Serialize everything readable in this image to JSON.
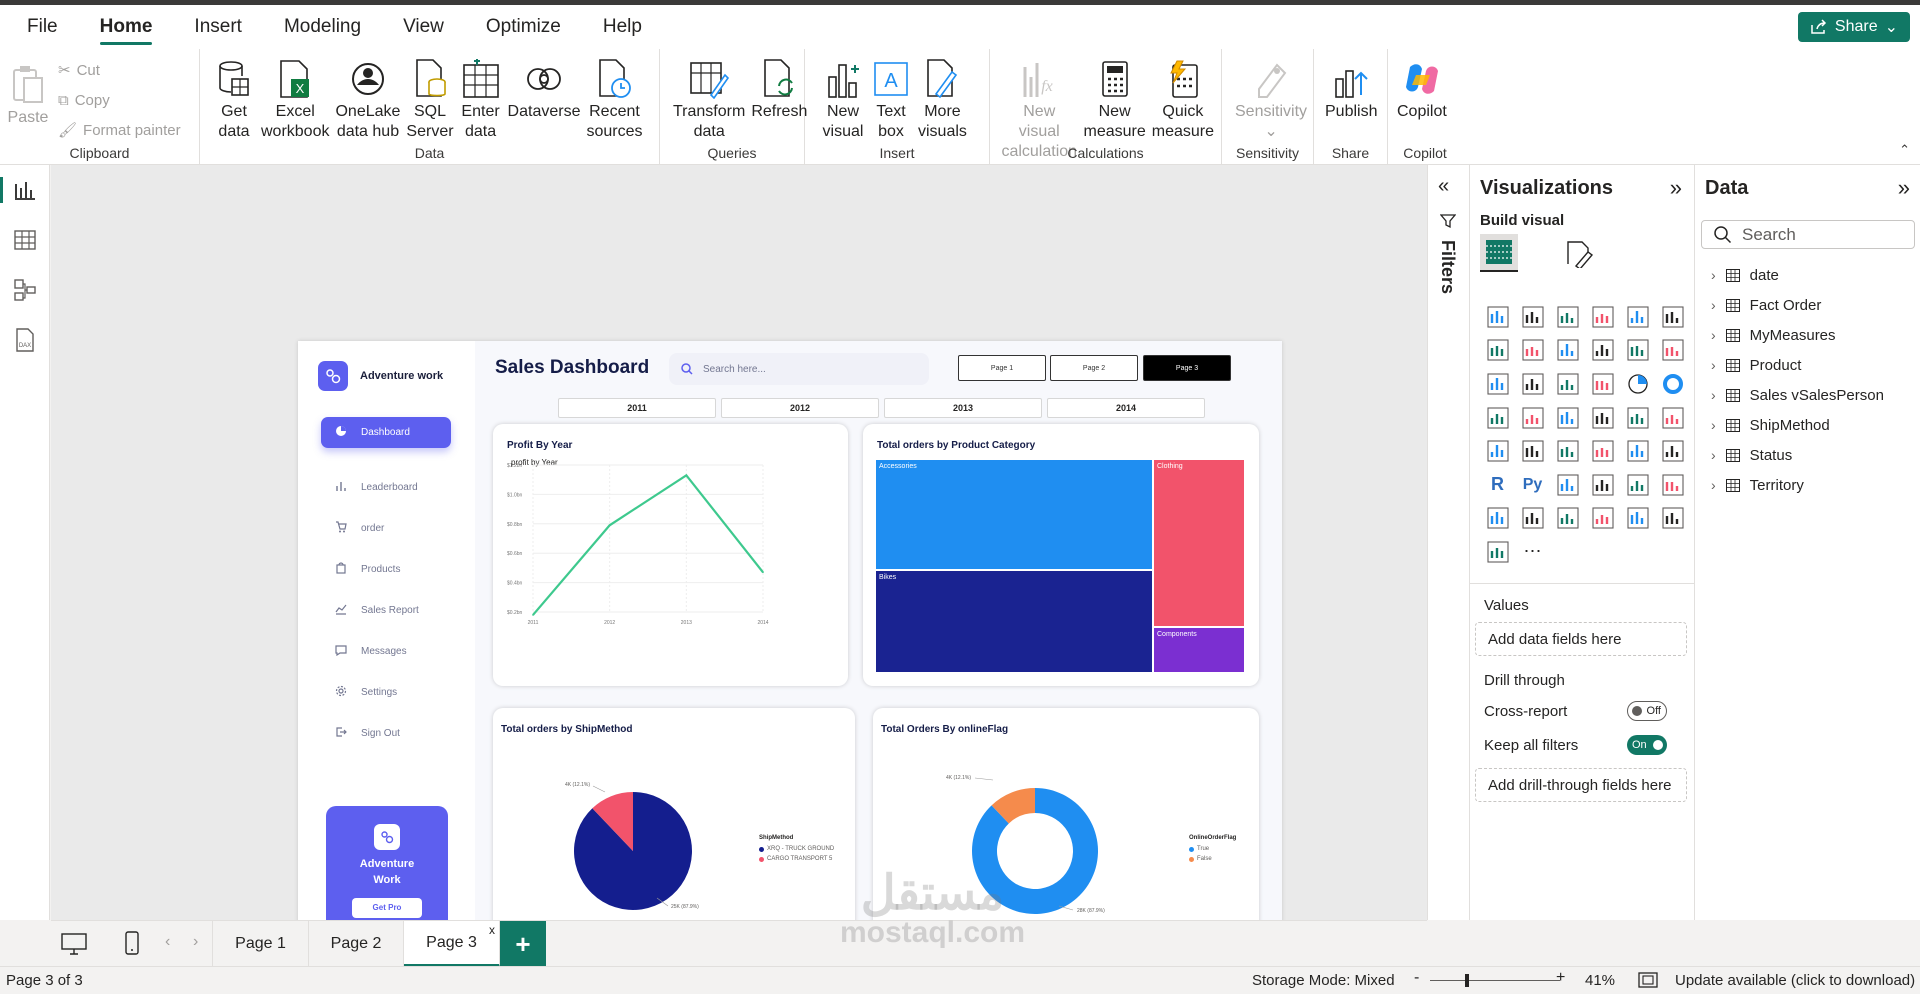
{
  "menu": {
    "file": "File",
    "home": "Home",
    "insert": "Insert",
    "modeling": "Modeling",
    "view": "View",
    "optimize": "Optimize",
    "help": "Help",
    "share": "Share"
  },
  "ribbon": {
    "clipboard": {
      "paste": "Paste",
      "cut": "Cut",
      "copy": "Copy",
      "format_painter": "Format painter",
      "label": "Clipboard"
    },
    "data": {
      "get_data_1": "Get",
      "get_data_2": "data",
      "excel_1": "Excel",
      "excel_2": "workbook",
      "onelake_1": "OneLake",
      "onelake_2": "data hub",
      "sql_1": "SQL",
      "sql_2": "Server",
      "enter_1": "Enter",
      "enter_2": "data",
      "dataverse": "Dataverse",
      "recent_1": "Recent",
      "recent_2": "sources",
      "label": "Data"
    },
    "queries": {
      "transform_1": "Transform",
      "transform_2": "data",
      "refresh": "Refresh",
      "label": "Queries"
    },
    "insert": {
      "new_visual_1": "New",
      "new_visual_2": "visual",
      "text_box_1": "Text",
      "text_box_2": "box",
      "more_visuals_1": "More",
      "more_visuals_2": "visuals",
      "label": "Insert"
    },
    "calculations": {
      "new_calc_1": "New visual",
      "new_calc_2": "calculation",
      "new_measure_1": "New",
      "new_measure_2": "measure",
      "quick_measure_1": "Quick",
      "quick_measure_2": "measure",
      "label": "Calculations"
    },
    "sensitivity": {
      "button": "Sensitivity",
      "label": "Sensitivity"
    },
    "share": {
      "publish": "Publish",
      "label": "Share"
    },
    "copilot": {
      "button": "Copilot",
      "label": "Copilot"
    }
  },
  "report": {
    "brand": "Adventure work",
    "title": "Sales Dashboard",
    "search_placeholder": "Search here...",
    "pages": [
      "Page 1",
      "Page 2",
      "Page 3"
    ],
    "years": [
      "2011",
      "2012",
      "2013",
      "2014"
    ],
    "nav": [
      "Dashboard",
      "Leaderboard",
      "order",
      "Products",
      "Sales Report",
      "Messages",
      "Settings",
      "Sign Out"
    ],
    "promo": {
      "line1": "Adventure",
      "line2": "Work",
      "button": "Get Pro"
    }
  },
  "chart_data": [
    {
      "type": "line",
      "title": "Profit By Year",
      "subtitle": "profit by Year",
      "x": [
        "2011",
        "2012",
        "2013",
        "2014"
      ],
      "series": [
        {
          "values": [
            0.18,
            0.79,
            1.13,
            0.47
          ]
        }
      ],
      "ytick_labels": [
        "$0.2bn",
        "$0.4bn",
        "$0.6bn",
        "$0.8bn",
        "$1.0bn",
        "$1.2bn"
      ],
      "ylim": [
        0.2,
        1.2
      ],
      "color": "#3ec98e"
    },
    {
      "type": "treemap",
      "title": "Total orders by Product Category",
      "categories": [
        "Accessories",
        "Bikes",
        "Clothing",
        "Components"
      ],
      "colors": [
        "#1f8ef1",
        "#1a2391",
        "#f2536b",
        "#7b2fd1"
      ]
    },
    {
      "type": "pie",
      "title": "Total orders by ShipMethod",
      "legend_title": "ShipMethod",
      "categories": [
        "XRQ - TRUCK GROUND",
        "CARGO TRANSPORT 5"
      ],
      "values": [
        87.9,
        12.1
      ],
      "data_labels": [
        "25K (87.9%)",
        "4K (12.1%)"
      ],
      "colors": [
        "#141e8e",
        "#f2536b"
      ]
    },
    {
      "type": "donut",
      "title": "Total Orders  By onlineFlag",
      "legend_title": "OnlineOrderFlag",
      "categories": [
        "True",
        "False"
      ],
      "values": [
        87.9,
        12.1
      ],
      "data_labels": [
        "28K (87.9%)",
        "4K (12.1%)"
      ],
      "colors": [
        "#1f8ef1",
        "#f58b4c"
      ]
    }
  ],
  "filters": {
    "label": "Filters"
  },
  "visualizations": {
    "title": "Visualizations",
    "build_visual": "Build visual",
    "values": "Values",
    "values_placeholder": "Add data fields here",
    "drill_through": "Drill through",
    "cross_report": "Cross-report",
    "cross_report_state": "Off",
    "keep_all_filters": "Keep all filters",
    "keep_all_filters_state": "On",
    "drill_placeholder": "Add drill-through fields here"
  },
  "data_pane": {
    "title": "Data",
    "search_placeholder": "Search",
    "fields": [
      "date",
      "Fact Order",
      "MyMeasures",
      "Product",
      "Sales vSalesPerson",
      "ShipMethod",
      "Status",
      "Territory"
    ]
  },
  "page_tabs": [
    "Page 1",
    "Page 2",
    "Page 3"
  ],
  "status": {
    "page": "Page 3 of 3",
    "storage": "Storage Mode: Mixed",
    "zoom": "41%",
    "update": "Update available (click to download)"
  },
  "watermark": {
    "line1": "مستقل",
    "line2": "mostaql.com"
  },
  "colors": {
    "accent": "#117865",
    "report_accent": "#5d5fef"
  }
}
